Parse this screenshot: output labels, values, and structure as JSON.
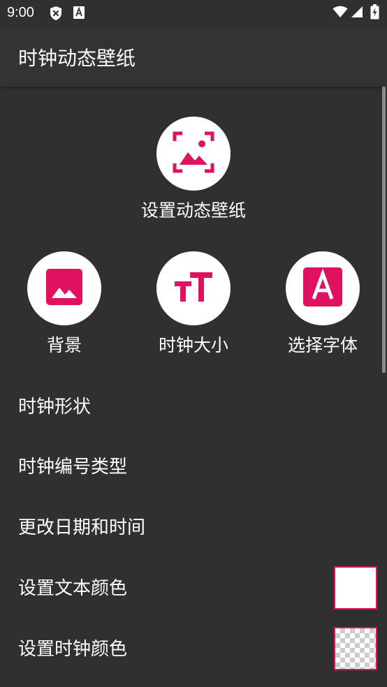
{
  "status_bar": {
    "time": "9:00",
    "icons_left": [
      "shield-x-icon",
      "font-a-icon"
    ],
    "icons_right": [
      "wifi-icon",
      "cell-signal-icon",
      "battery-charging-icon"
    ]
  },
  "app_bar": {
    "title": "时钟动态壁纸"
  },
  "primary_action": {
    "label": "设置动态壁纸",
    "icon": "wallpaper-frame-icon"
  },
  "quick_actions": [
    {
      "label": "背景",
      "icon": "image-icon"
    },
    {
      "label": "时钟大小",
      "icon": "text-size-icon"
    },
    {
      "label": "选择字体",
      "icon": "font-letter-a-icon"
    }
  ],
  "settings_list": [
    {
      "label": "时钟形状"
    },
    {
      "label": "时钟编号类型"
    },
    {
      "label": "更改日期和时间"
    },
    {
      "label": "设置文本颜色",
      "swatch": "white"
    },
    {
      "label": "设置时钟颜色",
      "swatch": "transparent"
    }
  ],
  "colors": {
    "background": "#303030",
    "app_bar": "#333333",
    "accent": "#E0115F",
    "text": "#FFFFFF"
  }
}
